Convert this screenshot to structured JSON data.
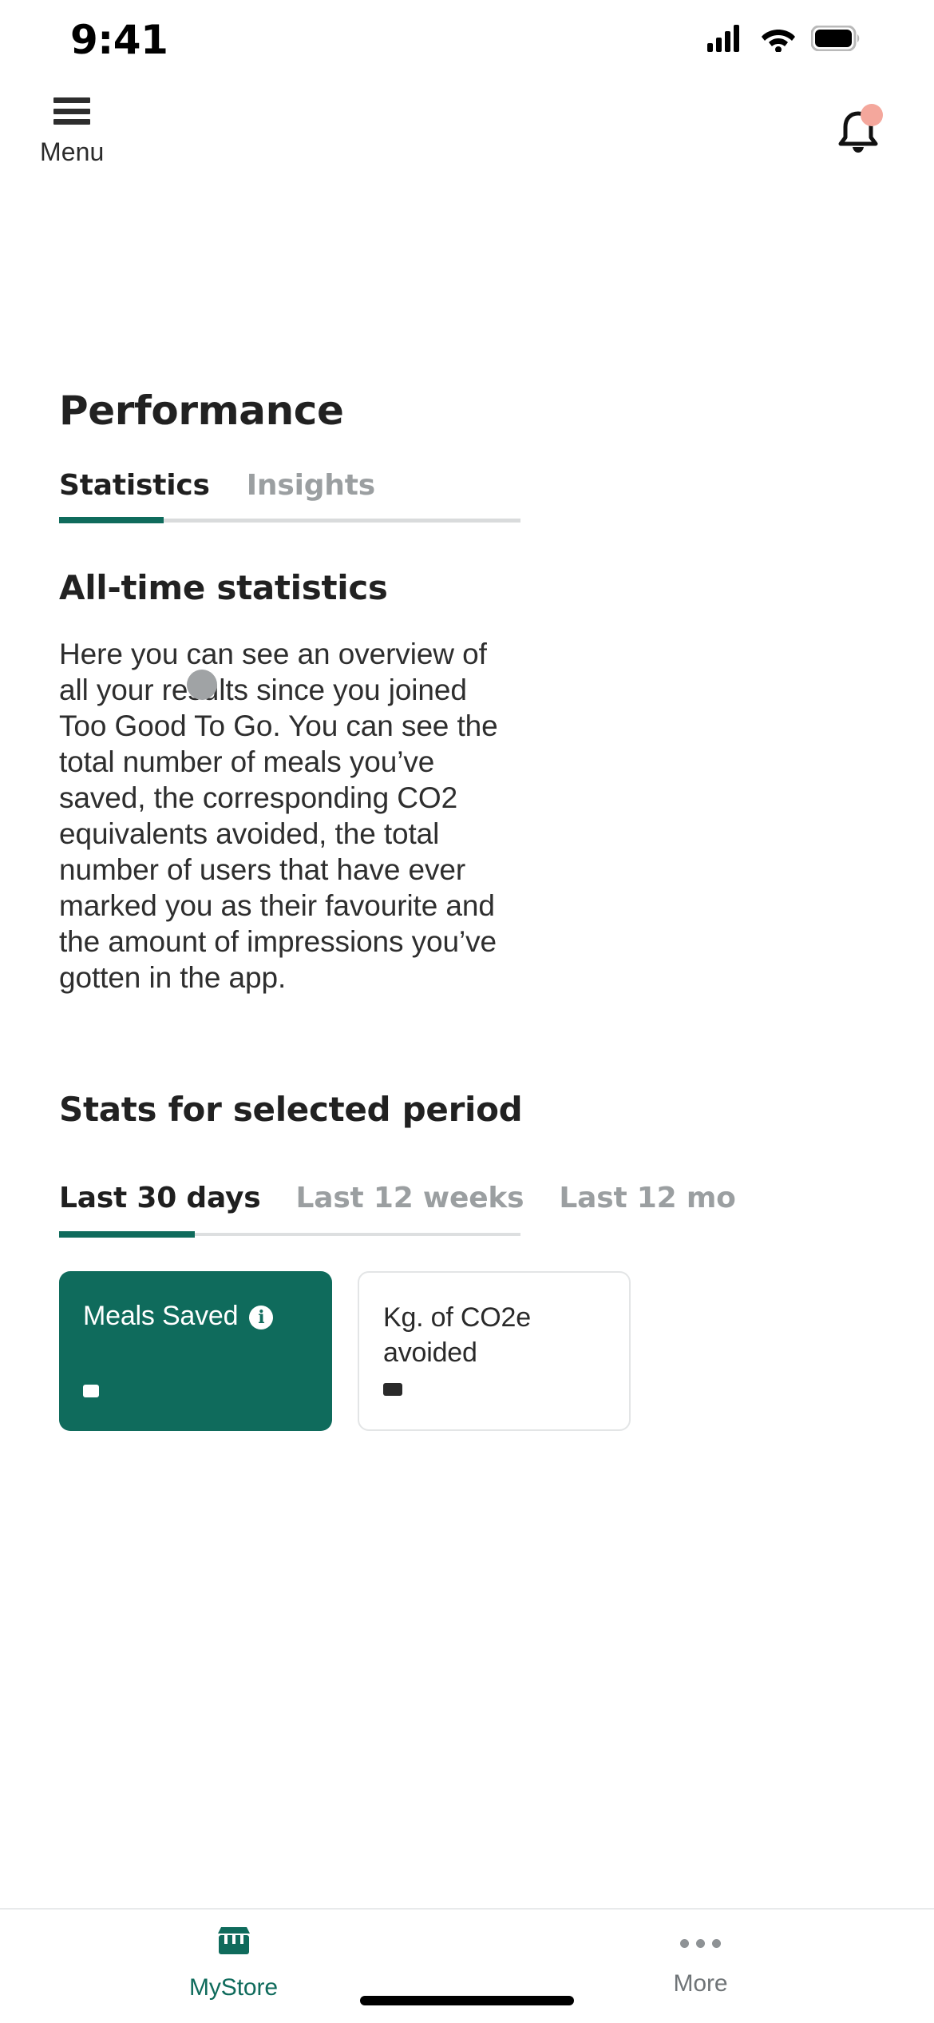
{
  "status_bar": {
    "time": "9:41",
    "cellular_icon": "cellular-signal-icon",
    "wifi_icon": "wifi-icon",
    "battery_icon": "battery-full-icon"
  },
  "header": {
    "menu_label": "Menu",
    "menu_icon": "hamburger-menu-icon",
    "notifications_icon": "bell-icon",
    "notification_badge": true
  },
  "page": {
    "title": "Performance"
  },
  "main_tabs": {
    "items": [
      {
        "label": "Statistics",
        "active": true
      },
      {
        "label": "Insights",
        "active": false
      }
    ],
    "active_color": "#0f6b5c"
  },
  "loading_indicator": {
    "shape": "circle",
    "color": "#a0a3a5"
  },
  "all_time": {
    "heading": "All-time statistics",
    "description": "Here you can see an overview of all your results since you joined Too Good To Go. You can see the total number of meals you’ve saved, the corresponding CO2 equivalents avoided, the total number of users that have ever marked you as their favourite and the amount of impressions you’ve gotten in the app."
  },
  "selected_period": {
    "heading": "Stats for selected period",
    "tabs": [
      {
        "label": "Last 30 days",
        "active": true
      },
      {
        "label": "Last 12 weeks",
        "active": false
      },
      {
        "label": "Last 12 mo",
        "active": false
      }
    ]
  },
  "stat_cards": [
    {
      "label": "Meals Saved",
      "value": "",
      "style": "primary",
      "info_icon": "info-icon",
      "info_glyph": "i",
      "background": "#0f6b5c"
    },
    {
      "label": "Kg. of CO2e avoided",
      "value": "",
      "style": "secondary",
      "background": "#ffffff"
    }
  ],
  "bottom_nav": {
    "items": [
      {
        "label": "MyStore",
        "icon": "storefront-icon",
        "active": true
      },
      {
        "label": "More",
        "icon": "ellipsis-icon",
        "active": false
      }
    ],
    "active_color": "#0f6b5c"
  }
}
